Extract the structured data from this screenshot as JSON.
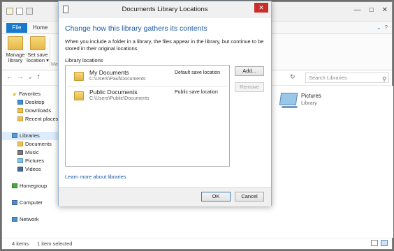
{
  "explorer": {
    "ribbon_tabs": {
      "file": "File",
      "home": "Home"
    },
    "ribbon_buttons": [
      {
        "label": "Manage library"
      },
      {
        "label": "Set save location ▾"
      }
    ],
    "ribbon_group_caption": "Ma",
    "search_placeholder": "Search Libraries",
    "nav": {
      "favorites": {
        "header": "Favorites",
        "items": [
          "Desktop",
          "Downloads",
          "Recent places"
        ]
      },
      "libraries": {
        "header": "Libraries",
        "items": [
          "Documents",
          "Music",
          "Pictures",
          "Videos"
        ]
      },
      "homegroup": "Homegroup",
      "computer": "Computer",
      "network": "Network"
    },
    "content_tile": {
      "name": "Pictures",
      "type": "Library"
    },
    "status": {
      "count": "4 items",
      "selected": "1 item selected"
    }
  },
  "dialog": {
    "title": "Documents Library Locations",
    "heading": "Change how this library gathers its contents",
    "description": "When you include a folder in a library, the files appear in the library, but continue to be stored in their original locations.",
    "locations_label": "Library locations",
    "locations": [
      {
        "name": "My Documents",
        "path": "C:\\Users\\Paul\\Documents",
        "status": "Default save location"
      },
      {
        "name": "Public Documents",
        "path": "C:\\Users\\Public\\Documents",
        "status": "Public save location"
      }
    ],
    "add_button": "Add...",
    "remove_button": "Remove",
    "learn_more_link": "Learn more about libraries",
    "ok_button": "OK",
    "cancel_button": "Cancel"
  },
  "colors": {
    "heading_blue": "#1b5aa8",
    "file_tab_blue": "#1979ca",
    "close_red": "#c7302a",
    "selection_blue": "#dcecfc"
  }
}
